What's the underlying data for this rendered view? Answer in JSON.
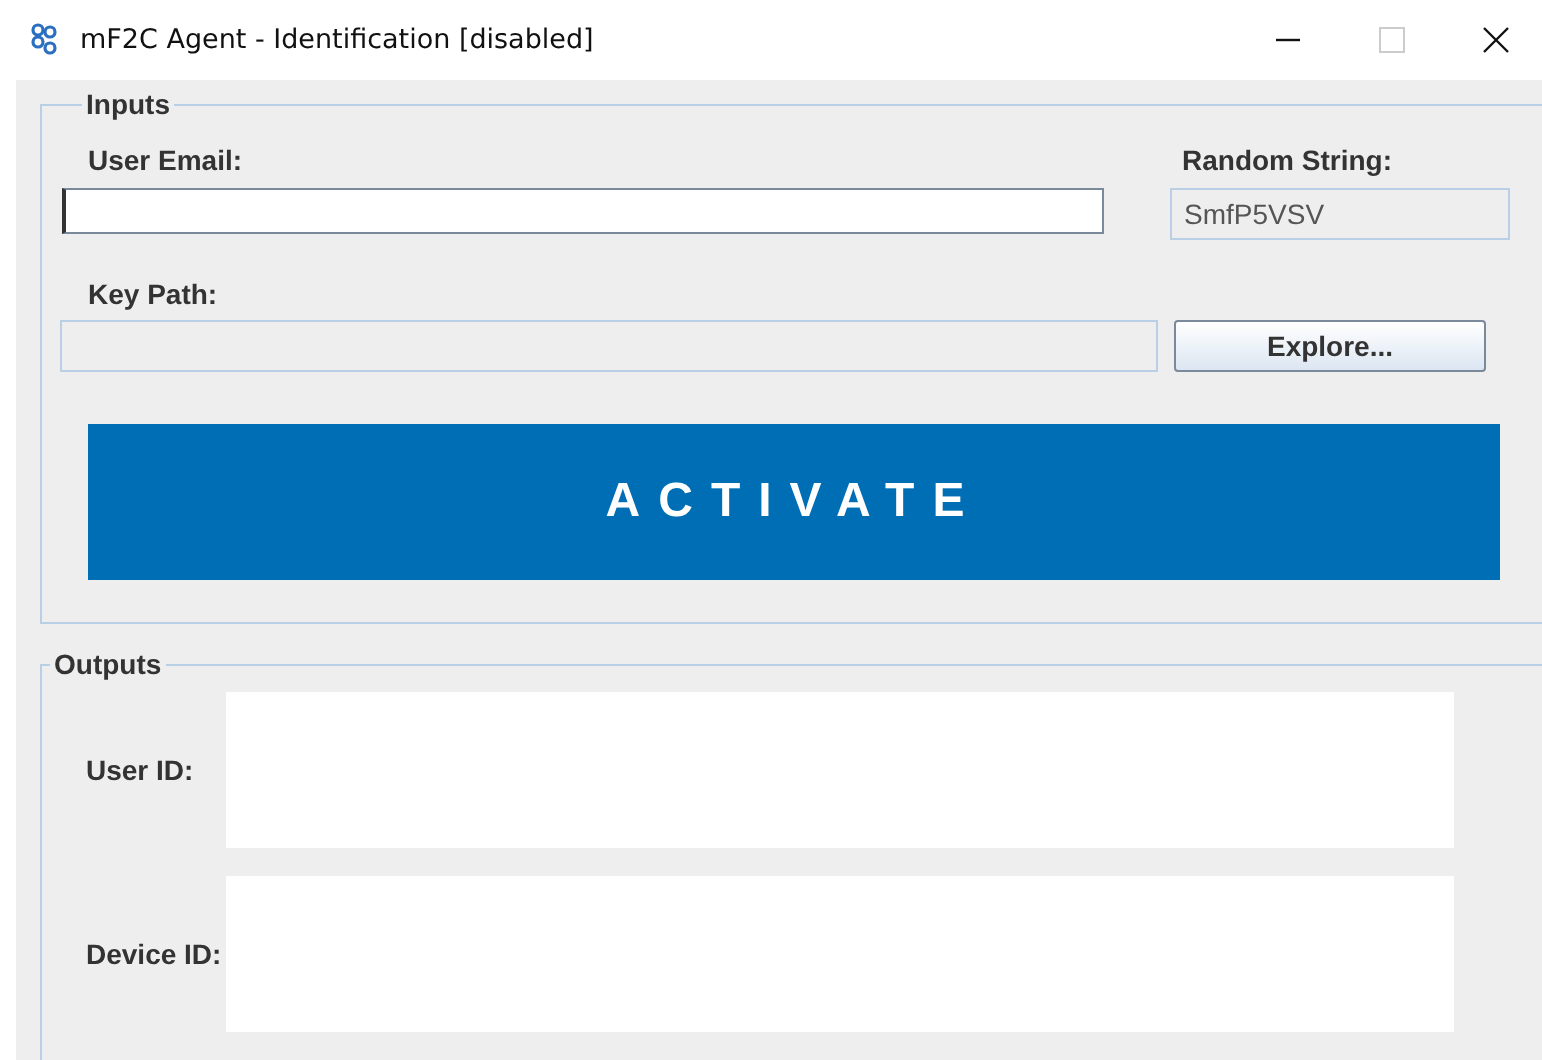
{
  "window": {
    "title": "mF2C Agent - Identification [disabled]"
  },
  "inputs": {
    "legend": "Inputs",
    "user_email": {
      "label": "User Email:",
      "disabled": false
    },
    "random_string": {
      "label": "Random String:",
      "value": "SmfP5VSV",
      "disabled": true
    },
    "key_path": {
      "label": "Key Path:",
      "disabled": true
    },
    "explore_button": "Explore...",
    "activate_button": "ACTIVATE"
  },
  "outputs": {
    "legend": "Outputs",
    "fields": [
      {
        "label": "User ID:"
      },
      {
        "label": "Device ID:"
      }
    ]
  }
}
